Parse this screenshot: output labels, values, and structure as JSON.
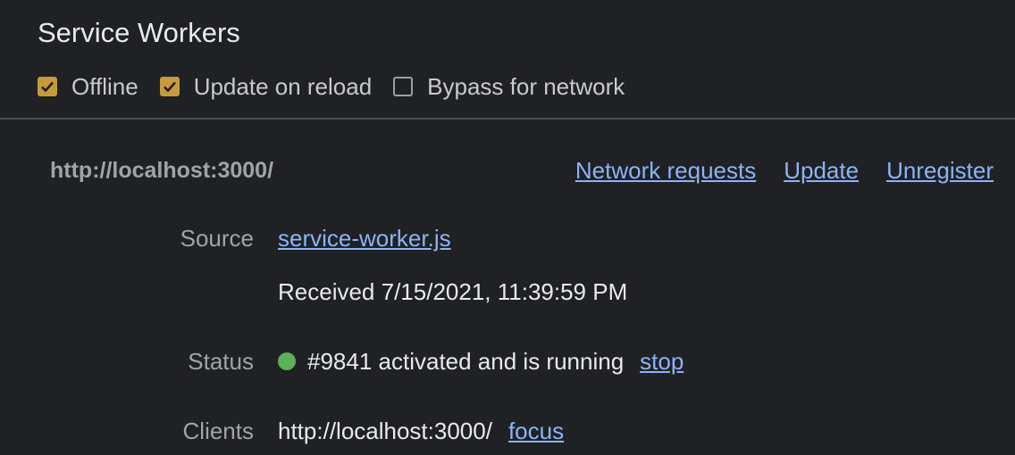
{
  "section_title": "Service Workers",
  "options": [
    {
      "label": "Offline",
      "checked": true
    },
    {
      "label": "Update on reload",
      "checked": true
    },
    {
      "label": "Bypass for network",
      "checked": false
    }
  ],
  "worker": {
    "origin": "http://localhost:3000/",
    "actions": {
      "network_requests": "Network requests",
      "update": "Update",
      "unregister": "Unregister"
    },
    "source": {
      "label": "Source",
      "file": "service-worker.js",
      "received": "Received 7/15/2021, 11:39:59 PM"
    },
    "status": {
      "label": "Status",
      "text": "#9841 activated and is running",
      "action": "stop",
      "dot_color": "#5bb05a"
    },
    "clients": {
      "label": "Clients",
      "url": "http://localhost:3000/",
      "action": "focus"
    }
  },
  "colors": {
    "background": "#202124",
    "checkbox_checked": "#c79a3b",
    "link": "#8ab4f8"
  }
}
